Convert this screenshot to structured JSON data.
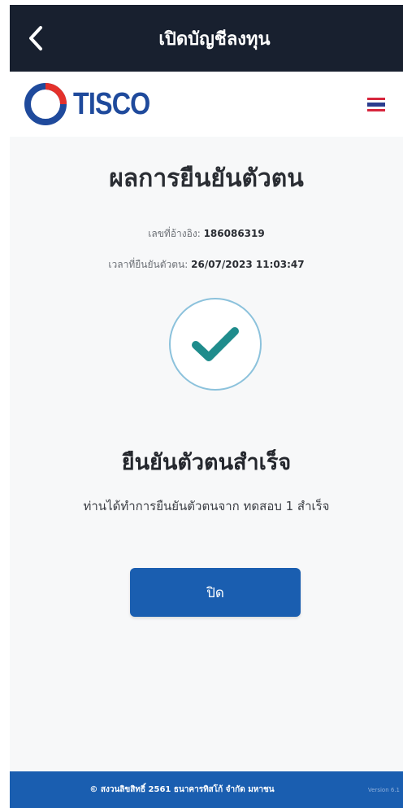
{
  "header": {
    "title": "เปิดบัญชีลงทุน",
    "back_icon": "chevron-left-icon",
    "background_color": "#18202f"
  },
  "brand": {
    "logo_text": "TISCO",
    "logo_colors": {
      "ring": "#e4312b",
      "ring_outer": "#1f4a9c",
      "text": "#1f4a9c"
    },
    "language_icon": "thai-flag-icon"
  },
  "result": {
    "title": "ผลการยืนยันตัวตน",
    "reference_label": "เลขที่อ้างอิง:",
    "reference_value": "186086319",
    "time_label": "เวลาที่ยืนยันตัวตน:",
    "time_value": "26/07/2023 11:03:47",
    "status_icon": "check-circle-icon",
    "check_color": "#1f8c8c",
    "success_title": "ยืนยันตัวตนสำเร็จ",
    "success_description": "ท่านได้ทำการยืนยันตัวตนจาก ทดสอบ 1 สำเร็จ"
  },
  "actions": {
    "close_label": "ปิด",
    "button_color": "#1a5eb0"
  },
  "footer": {
    "copyright": "© สงวนลิขสิทธิ์ 2561 ธนาคารทิสโก้ จำกัด มหาชน",
    "version": "Version 6.1"
  }
}
